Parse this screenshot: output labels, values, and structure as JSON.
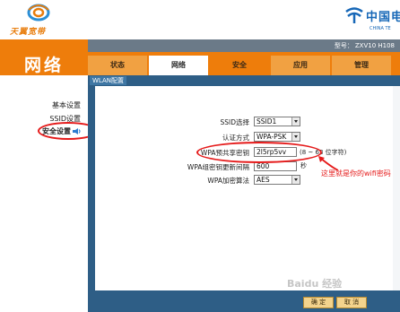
{
  "header": {
    "brand_left": "天翼宽带",
    "brand_right_cn": "中国电",
    "brand_right_en": "CHINA TE",
    "model_label": "型号：",
    "model_value": "ZXV10 H108"
  },
  "section_title": "网络",
  "tabs": [
    {
      "label": "状态",
      "active": false
    },
    {
      "label": "网络",
      "active": true
    },
    {
      "label": "安全",
      "active": false
    },
    {
      "label": "应用",
      "active": false
    },
    {
      "label": "管理",
      "active": false
    }
  ],
  "subnav": {
    "label": "WLAN配置"
  },
  "leftnav": {
    "items": [
      {
        "label": "基本设置"
      },
      {
        "label": "SSID设置"
      },
      {
        "label": "安全设置",
        "selected": true
      }
    ]
  },
  "form": {
    "ssid_select": {
      "label": "SSID选择",
      "value": "SSID1"
    },
    "auth_mode": {
      "label": "认证方式",
      "value": "WPA-PSK"
    },
    "psk": {
      "label": "WPA预共享密钥",
      "value": "2l5rp5vv",
      "hint": "(8 ~ 63 位字符)"
    },
    "rekey": {
      "label": "WPA组密钥更新间隔",
      "value": "600",
      "unit": "秒"
    },
    "encryption": {
      "label": "WPA加密算法",
      "value": "AES"
    }
  },
  "annotation": {
    "text": "这里就是你的wifi密码"
  },
  "footer": {
    "ok_label": "确 定",
    "cancel_label": "取 消"
  },
  "watermark": "Baidu 经验",
  "colors": {
    "orange": "#ee7d0b",
    "navy": "#2e5e86",
    "annotation_red": "#e51a1a"
  }
}
